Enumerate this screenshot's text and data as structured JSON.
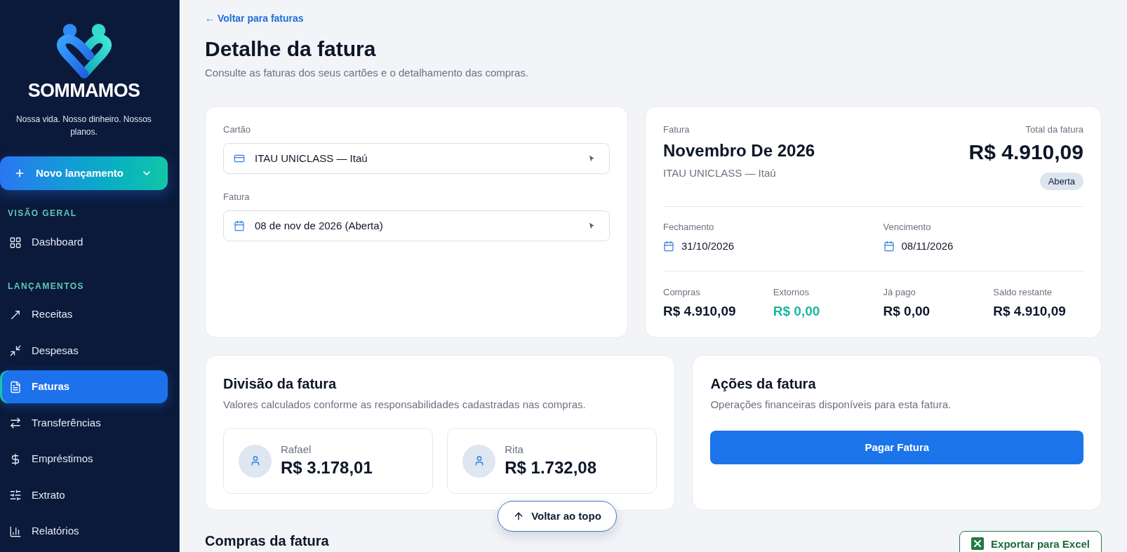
{
  "sidebar": {
    "brand": "SOMMAMOS",
    "tagline": "Nossa vida. Nosso dinheiro. Nossos planos.",
    "new_entry_button": "Novo lançamento",
    "sections": [
      {
        "title": "VISÃO GERAL",
        "items": [
          {
            "label": "Dashboard",
            "selected": false
          }
        ]
      },
      {
        "title": "LANÇAMENTOS",
        "items": [
          {
            "label": "Receitas",
            "selected": false
          },
          {
            "label": "Despesas",
            "selected": false
          },
          {
            "label": "Faturas",
            "selected": true
          },
          {
            "label": "Transferências",
            "selected": false
          },
          {
            "label": "Empréstimos",
            "selected": false
          },
          {
            "label": "Extrato",
            "selected": false
          },
          {
            "label": "Relatórios",
            "selected": false
          }
        ]
      }
    ]
  },
  "back_link": "← Voltar para faturas",
  "page": {
    "title": "Detalhe da fatura",
    "subtitle": "Consulte as faturas dos seus cartões e o detalhamento das compras."
  },
  "selectors": [
    {
      "label": "Cartão",
      "value": "ITAU UNICLASS — Itaú"
    },
    {
      "label": "Fatura",
      "value": "08 de nov de 2026 (Aberta)"
    }
  ],
  "invoice_summary": {
    "label": "Fatura",
    "title": "Novembro De 2026",
    "card": "ITAU UNICLASS — Itaú",
    "total_label": "Total da fatura",
    "total": "R$ 4.910,09",
    "status": "Aberta",
    "dates": [
      {
        "label": "Fechamento",
        "value": "31/10/2026"
      },
      {
        "label": "Vencimento",
        "value": "08/11/2026"
      }
    ],
    "stats": [
      {
        "label": "Compras",
        "value": "R$ 4.910,09",
        "color": "#0f172a"
      },
      {
        "label": "Extornos",
        "value": "R$ 0,00",
        "color": "#1db89b"
      },
      {
        "label": "Já pago",
        "value": "R$ 0,00",
        "color": "#0f172a"
      },
      {
        "label": "Saldo restante",
        "value": "R$ 4.910,09",
        "color": "#0f172a"
      }
    ]
  },
  "division": {
    "title": "Divisão da fatura",
    "subtitle": "Valores calculados conforme as responsabilidades cadastradas nas compras.",
    "people": [
      {
        "name": "Rafael",
        "amount": "R$ 3.178,01"
      },
      {
        "name": "Rita",
        "amount": "R$ 1.732,08"
      }
    ]
  },
  "actions": {
    "title": "Ações da fatura",
    "subtitle": "Operações financeiras disponíveis para esta fatura.",
    "buttons": [
      "Pagar Fatura"
    ]
  },
  "purchases": {
    "title": "Compras da fatura",
    "export_button": "Exportar para Excel"
  },
  "scroll_top_button": "Voltar ao topo"
}
